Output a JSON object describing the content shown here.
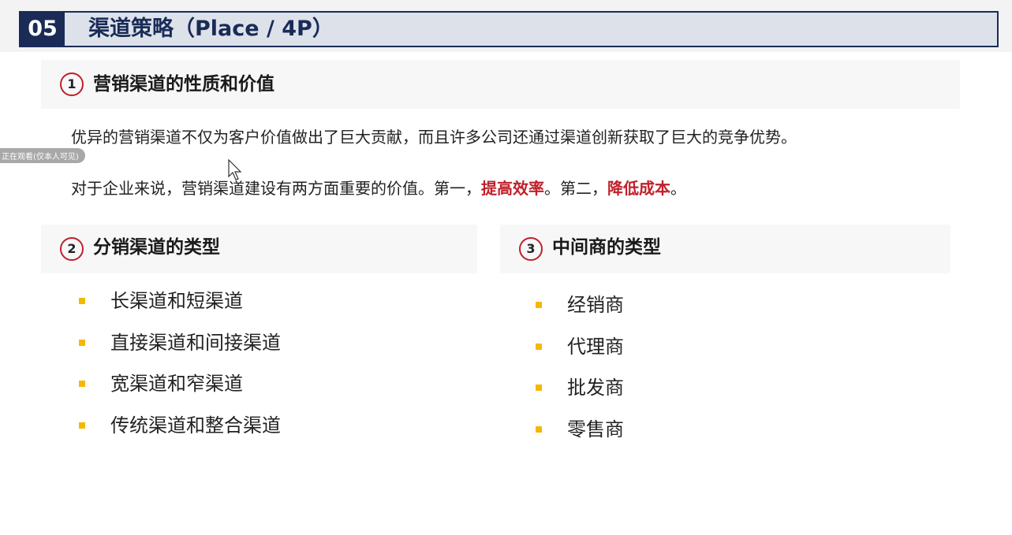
{
  "header": {
    "number": "05",
    "title": "渠道策略（Place / 4P）"
  },
  "section1": {
    "number": "1",
    "title": "营销渠道的性质和价值",
    "para1": "优异的营销渠道不仅为客户价值做出了巨大贡献，而且许多公司还通过渠道创新获取了巨大的竞争优势。",
    "para2_prefix": "对于企业来说，营销渠道建设有两方面重要的价值。第一，",
    "para2_highlight1": "提高效率",
    "para2_middle": "。第二，",
    "para2_highlight2": "降低成本",
    "para2_suffix": "。"
  },
  "section2": {
    "number": "2",
    "title": "分销渠道的类型",
    "items": [
      "长渠道和短渠道",
      "直接渠道和间接渠道",
      "宽渠道和窄渠道",
      "传统渠道和整合渠道"
    ]
  },
  "section3": {
    "number": "3",
    "title": "中间商的类型",
    "items": [
      "经销商",
      "代理商",
      "批发商",
      "零售商"
    ]
  },
  "overlay_text": "正在观看(仅本人可见)",
  "colors": {
    "accent_navy": "#1a2b57",
    "highlight_red": "#c0202a",
    "bullet_yellow": "#f5b800"
  },
  "icons": {
    "bullet": "square-bullet-icon",
    "cursor": "mouse-cursor-icon"
  }
}
